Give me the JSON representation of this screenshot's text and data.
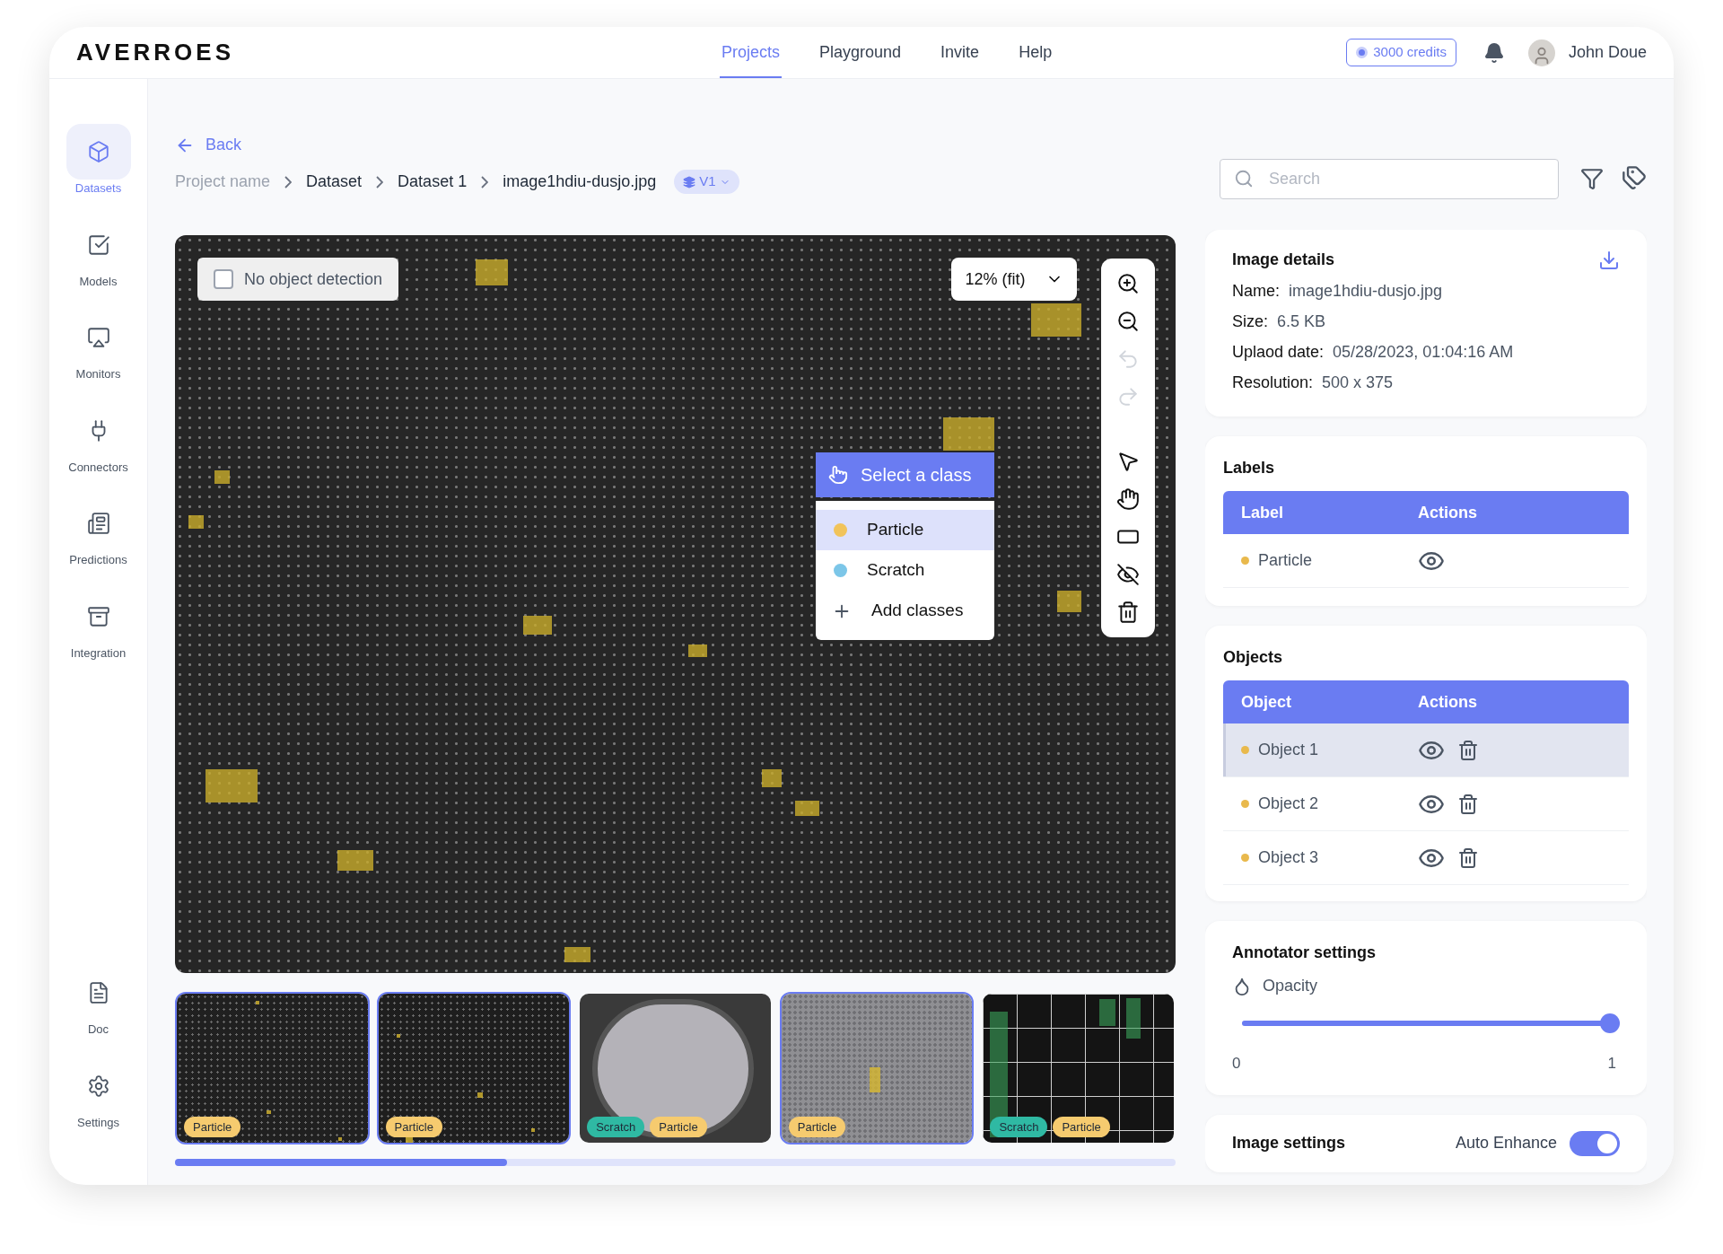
{
  "header": {
    "logo": "AVERROES",
    "nav": [
      {
        "label": "Projects",
        "selected": true
      },
      {
        "label": "Playground",
        "selected": false
      },
      {
        "label": "Invite",
        "selected": false
      },
      {
        "label": "Help",
        "selected": false
      }
    ],
    "credits": "3000 credits",
    "user": "John Doue"
  },
  "sidebar": {
    "items": [
      {
        "label": "Datasets",
        "selected": true,
        "kind": "datasets"
      },
      {
        "label": "Models",
        "selected": false,
        "kind": "models"
      },
      {
        "label": "Monitors",
        "selected": false,
        "kind": "monitors"
      },
      {
        "label": "Connectors",
        "selected": false,
        "kind": "connectors"
      },
      {
        "label": "Predictions",
        "selected": false,
        "kind": "predictions"
      },
      {
        "label": "Integration",
        "selected": false,
        "kind": "integration"
      }
    ],
    "bottom_items": [
      {
        "label": "Doc",
        "selected": false,
        "kind": "doc"
      },
      {
        "label": "Settings",
        "selected": false,
        "kind": "settings"
      }
    ]
  },
  "back": "Back",
  "breadcrumb": [
    "Project name",
    "Dataset",
    "Dataset 1",
    "image1hdiu-dusjo.jpg"
  ],
  "version": "V1",
  "search": {
    "placeholder": "Search"
  },
  "canvas": {
    "no_detection": {
      "label": "No object detection",
      "checked": false
    },
    "zoom": "12% (fit)",
    "tools": [
      {
        "kind": "zoom-in",
        "disabled": false
      },
      {
        "kind": "zoom-out",
        "disabled": false
      },
      {
        "kind": "undo",
        "disabled": true
      },
      {
        "kind": "redo",
        "disabled": true
      },
      {
        "kind": "select",
        "disabled": false
      },
      {
        "kind": "pan",
        "disabled": false
      },
      {
        "kind": "box",
        "disabled": false
      },
      {
        "kind": "hide",
        "disabled": false
      },
      {
        "kind": "delete",
        "disabled": false
      }
    ],
    "class_menu": {
      "title": "Select a class",
      "items": [
        {
          "label": "Particle",
          "color": "#f1c35a",
          "selected": true
        },
        {
          "label": "Scratch",
          "color": "#7cc6e8",
          "selected": false
        }
      ],
      "add": "Add classes"
    }
  },
  "thumbnails": [
    {
      "selected": true,
      "tags": [
        {
          "label": "Particle",
          "color": "#f6cb6f"
        }
      ]
    },
    {
      "selected": true,
      "tags": [
        {
          "label": "Particle",
          "color": "#f6cb6f"
        }
      ]
    },
    {
      "selected": false,
      "tags": [
        {
          "label": "Scratch",
          "color": "#2fb9a3"
        },
        {
          "label": "Particle",
          "color": "#f6cb6f"
        }
      ]
    },
    {
      "selected": true,
      "tags": [
        {
          "label": "Particle",
          "color": "#f6cb6f"
        }
      ]
    },
    {
      "selected": false,
      "tags": [
        {
          "label": "Scratch",
          "color": "#2fb9a3"
        },
        {
          "label": "Particle",
          "color": "#f6cb6f"
        }
      ]
    }
  ],
  "image_details": {
    "title": "Image details",
    "fields": [
      {
        "label": "Name:",
        "value": "image1hdiu-dusjo.jpg"
      },
      {
        "label": "Size:",
        "value": "6.5 KB"
      },
      {
        "label": "Uplaod date:",
        "value": "05/28/2023, 01:04:16 AM"
      },
      {
        "label": "Resolution:",
        "value": "500 x 375"
      }
    ]
  },
  "labels": {
    "title": "Labels",
    "columns": [
      "Label",
      "Actions"
    ],
    "rows": [
      {
        "name": "Particle",
        "color": "#e9b94c"
      }
    ]
  },
  "objects": {
    "title": "Objects",
    "columns": [
      "Object",
      "Actions"
    ],
    "rows": [
      {
        "name": "Object 1",
        "color": "#e9b94c",
        "selected": true
      },
      {
        "name": "Object 2",
        "color": "#e9b94c",
        "selected": false
      },
      {
        "name": "Object 3",
        "color": "#e9b94c",
        "selected": false
      }
    ]
  },
  "annotator": {
    "title": "Annotator settings",
    "opacity": {
      "label": "Opacity",
      "level": 1,
      "min": "0",
      "max": "1"
    }
  },
  "image_settings": {
    "title": "Image settings",
    "auto_enhance": {
      "label": "Auto Enhance",
      "on": true
    }
  }
}
